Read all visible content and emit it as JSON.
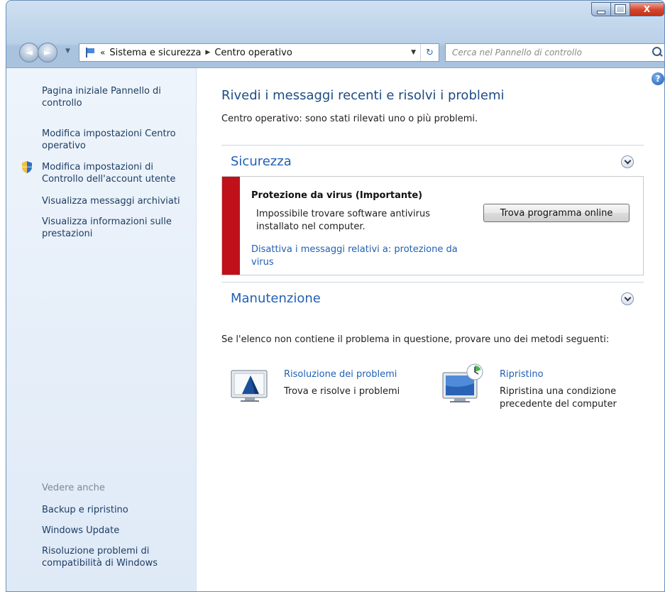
{
  "window": {
    "minimize_glyph": "",
    "maximize_glyph": "",
    "close_glyph": "X"
  },
  "navigation": {
    "back_glyph": "◄",
    "forward_glyph": "►",
    "history_glyph": "▼",
    "breadcrumb_more": "«",
    "breadcrumb": [
      "Sistema e sicurezza",
      "Centro operativo"
    ],
    "breadcrumb_separator": "▶",
    "address_dropdown_glyph": "▼",
    "refresh_glyph": "↻",
    "search_placeholder": "Cerca nel Pannello di controllo"
  },
  "help": {
    "glyph": "?"
  },
  "sidebar": {
    "links": [
      {
        "label": "Pagina iniziale Pannello di controllo"
      },
      {
        "label": "Modifica impostazioni Centro operativo"
      },
      {
        "label": "Modifica impostazioni di Controllo dell'account utente"
      },
      {
        "label": "Visualizza messaggi archiviati"
      },
      {
        "label": "Visualizza informazioni sulle prestazioni"
      }
    ],
    "see_also_label": "Vedere anche",
    "see_also_links": [
      {
        "label": "Backup e ripristino"
      },
      {
        "label": "Windows Update"
      },
      {
        "label": "Risoluzione problemi di compatibilità di Windows"
      }
    ]
  },
  "main": {
    "title": "Rivedi i messaggi recenti e risolvi i problemi",
    "subtitle": "Centro operativo: sono stati rilevati uno o più problemi.",
    "security": {
      "title": "Sicurezza",
      "alert": {
        "title": "Protezione da virus (Importante)",
        "description": "Impossibile trovare software antivirus installato nel computer.",
        "button_label": "Trova programma online",
        "link_label": "Disattiva i messaggi relativi a: protezione da virus",
        "stripe_color": "#c0101a"
      }
    },
    "maintenance": {
      "title": "Manutenzione"
    },
    "hint": "Se l'elenco non contiene il problema in questione, provare uno dei metodi seguenti:",
    "tools": [
      {
        "title": "Risoluzione dei problemi",
        "description": "Trova e risolve i problemi"
      },
      {
        "title": "Ripristino",
        "description": "Ripristina una condizione precedente del computer"
      }
    ]
  },
  "colors": {
    "link": "#2160b5",
    "title": "#1e4b85",
    "sidebar_link": "#1e3e64"
  }
}
